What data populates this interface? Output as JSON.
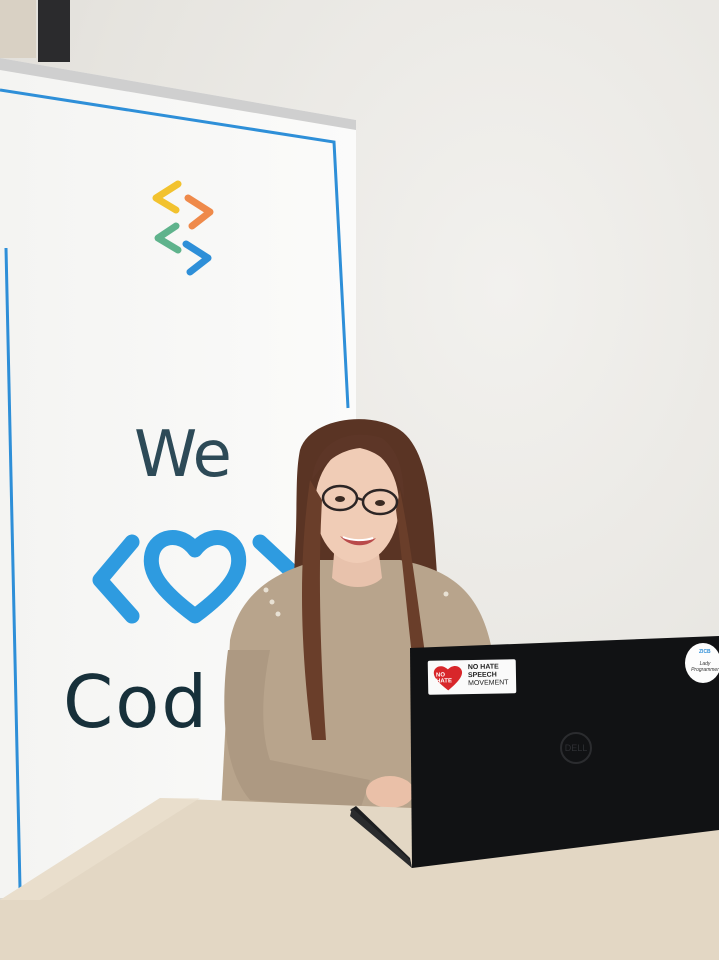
{
  "photo": {
    "banner": {
      "line1": "We",
      "line2": "Cod",
      "colors": {
        "border": "#2e8fd8",
        "heart": "#2e9be0",
        "text": "#2d4a57"
      },
      "logo_icon": "code-chevrons-logo"
    },
    "laptop": {
      "brand": "DELL",
      "sticker_left": {
        "heart_text": "NO HATE",
        "lines": [
          "NO HATE",
          "SPEECH",
          "MOVEMENT"
        ]
      },
      "sticker_right": {
        "top": "ZICB",
        "bottom": "Lady Programmer"
      }
    }
  }
}
